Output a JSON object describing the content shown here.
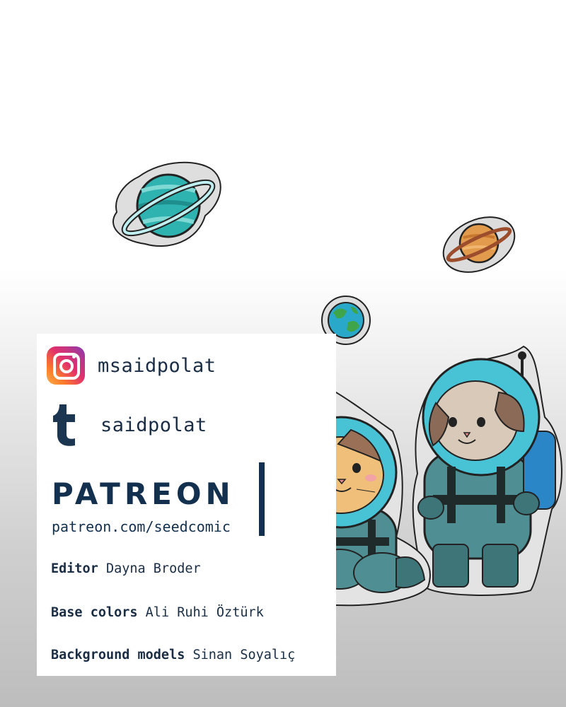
{
  "social": {
    "instagram": {
      "icon": "instagram-icon",
      "handle": "msaidpolat"
    },
    "tumblr": {
      "icon": "tumblr-icon",
      "handle": "saidpolat"
    }
  },
  "patreon": {
    "wordmark": "PATREON",
    "url": "patreon.com/seedcomic"
  },
  "credits": [
    {
      "role": "Editor",
      "name": "Dayna Broder"
    },
    {
      "role": "Base colors",
      "name": "Ali Ruhi Öztürk"
    },
    {
      "role": "Background models",
      "name": "Sinan Soyalıç"
    }
  ],
  "colors": {
    "text_navy": "#13304f",
    "planet_teal": "#2fb3b0",
    "planet_orange": "#e29a4d",
    "helmet_blue": "#48c3d6",
    "suit_teal": "#4f8e92"
  }
}
